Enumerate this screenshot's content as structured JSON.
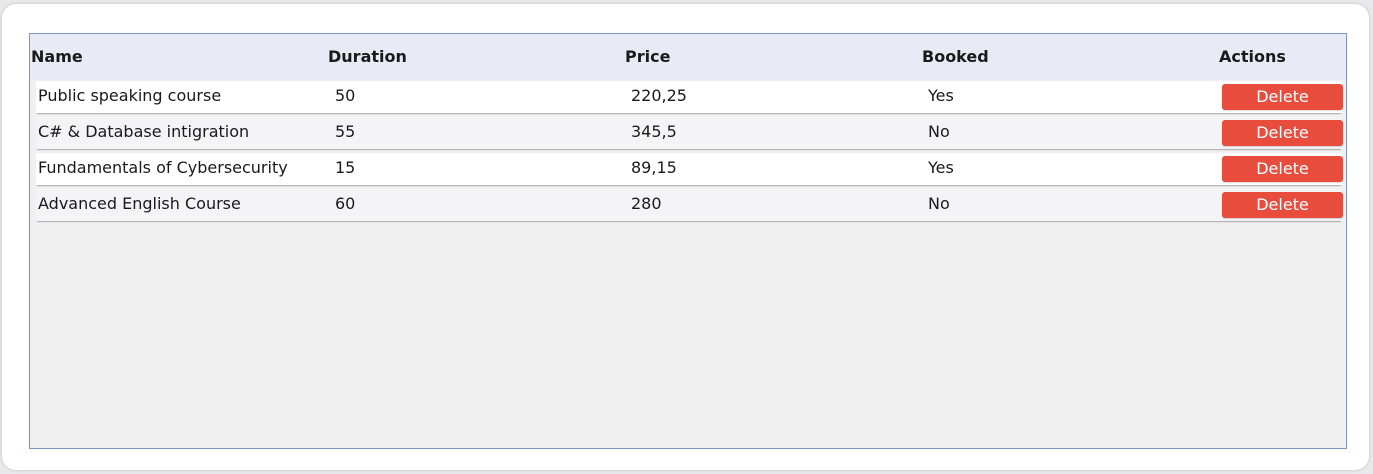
{
  "table": {
    "columns": [
      "Name",
      "Duration",
      "Price",
      "Booked",
      "Actions"
    ],
    "rows": [
      {
        "name": "Public speaking course",
        "duration": "50",
        "price": "220,25",
        "booked": "Yes",
        "action": "Delete"
      },
      {
        "name": "C# & Database intigration",
        "duration": "55",
        "price": "345,5",
        "booked": "No",
        "action": "Delete"
      },
      {
        "name": "Fundamentals of Cybersecurity",
        "duration": "15",
        "price": "89,15",
        "booked": "Yes",
        "action": "Delete"
      },
      {
        "name": "Advanced English Course",
        "duration": "60",
        "price": "280",
        "booked": "No",
        "action": "Delete"
      }
    ]
  },
  "colors": {
    "delete_button": "#e74c3c",
    "header_background": "#e8eaf5",
    "grid_border": "#7a96b8",
    "grid_background": "#f0f0f0"
  }
}
